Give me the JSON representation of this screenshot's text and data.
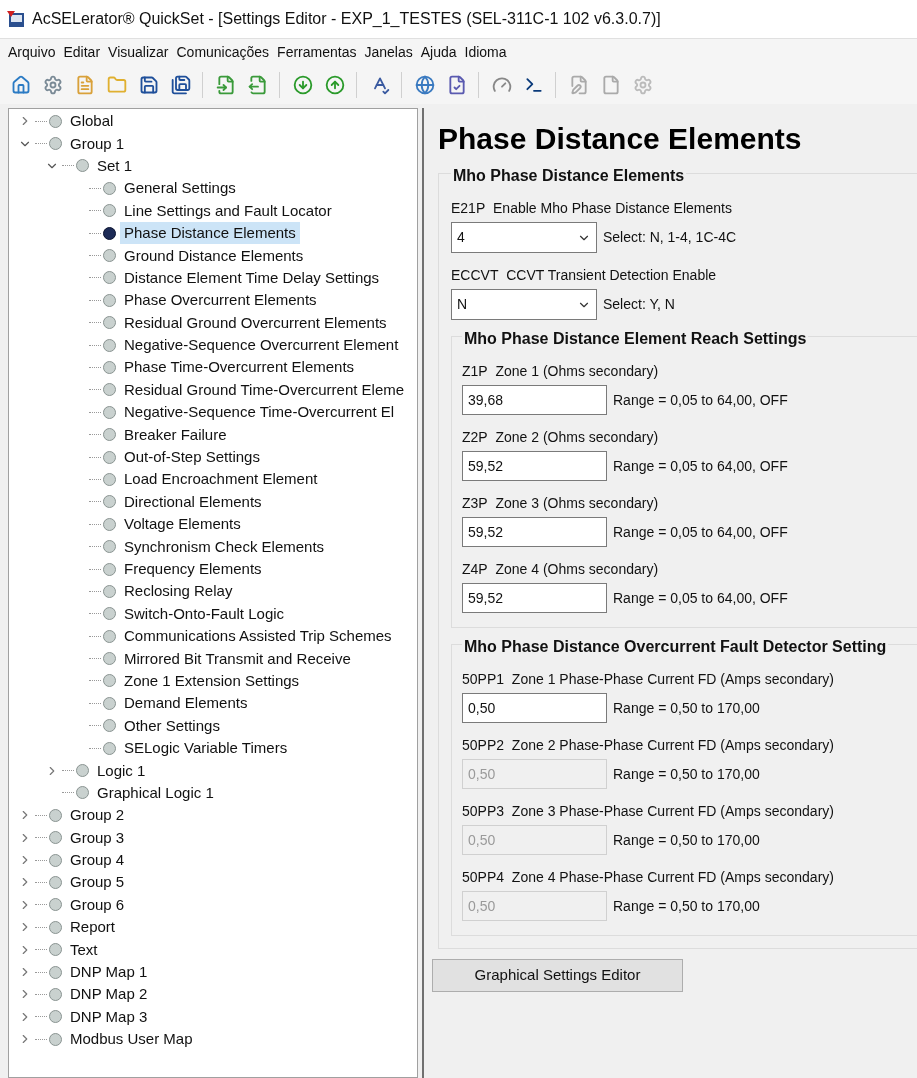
{
  "window": {
    "title": "AcSELerator® QuickSet - [Settings Editor - EXP_1_TESTES (SEL-311C-1 102 v6.3.0.7)]"
  },
  "menu": [
    "Arquivo",
    "Editar",
    "Visualizar",
    "Comunicações",
    "Ferramentas",
    "Janelas",
    "Ajuda",
    "Idioma"
  ],
  "tree": [
    {
      "label": "Global",
      "expanded": false,
      "selected": false
    },
    {
      "label": "Group 1",
      "expanded": true,
      "selected": false,
      "children": [
        {
          "label": "Set 1",
          "expanded": true,
          "selected": false,
          "children": [
            {
              "label": "General Settings",
              "selected": false
            },
            {
              "label": "Line Settings and Fault Locator",
              "selected": false
            },
            {
              "label": "Phase Distance Elements",
              "selected": true
            },
            {
              "label": "Ground Distance Elements",
              "selected": false
            },
            {
              "label": "Distance Element Time Delay Settings",
              "selected": false
            },
            {
              "label": "Phase Overcurrent Elements",
              "selected": false
            },
            {
              "label": "Residual Ground Overcurrent Elements",
              "selected": false
            },
            {
              "label": "Negative-Sequence Overcurrent Element",
              "selected": false
            },
            {
              "label": "Phase Time-Overcurrent Elements",
              "selected": false
            },
            {
              "label": "Residual Ground Time-Overcurrent Eleme",
              "selected": false
            },
            {
              "label": "Negative-Sequence Time-Overcurrent El",
              "selected": false
            },
            {
              "label": "Breaker Failure",
              "selected": false
            },
            {
              "label": "Out-of-Step Settings",
              "selected": false
            },
            {
              "label": "Load Encroachment Element",
              "selected": false
            },
            {
              "label": "Directional Elements",
              "selected": false
            },
            {
              "label": "Voltage Elements",
              "selected": false
            },
            {
              "label": "Synchronism Check Elements",
              "selected": false
            },
            {
              "label": "Frequency Elements",
              "selected": false
            },
            {
              "label": "Reclosing Relay",
              "selected": false
            },
            {
              "label": "Switch-Onto-Fault Logic",
              "selected": false
            },
            {
              "label": "Communications Assisted Trip Schemes",
              "selected": false
            },
            {
              "label": "Mirrored Bit Transmit and Receive",
              "selected": false
            },
            {
              "label": "Zone 1 Extension Settings",
              "selected": false
            },
            {
              "label": "Demand Elements",
              "selected": false
            },
            {
              "label": "Other Settings",
              "selected": false
            },
            {
              "label": "SELogic Variable Timers",
              "selected": false
            }
          ]
        },
        {
          "label": "Logic 1",
          "expanded": false,
          "selected": false
        },
        {
          "label": "Graphical Logic 1",
          "selected": false
        }
      ]
    },
    {
      "label": "Group 2",
      "expanded": false,
      "selected": false
    },
    {
      "label": "Group 3",
      "expanded": false,
      "selected": false
    },
    {
      "label": "Group 4",
      "expanded": false,
      "selected": false
    },
    {
      "label": "Group 5",
      "expanded": false,
      "selected": false
    },
    {
      "label": "Group 6",
      "expanded": false,
      "selected": false
    },
    {
      "label": "Report",
      "expanded": false,
      "selected": false
    },
    {
      "label": "Text",
      "expanded": false,
      "selected": false
    },
    {
      "label": "DNP Map 1",
      "expanded": false,
      "selected": false
    },
    {
      "label": "DNP Map 2",
      "expanded": false,
      "selected": false
    },
    {
      "label": "DNP Map 3",
      "expanded": false,
      "selected": false
    },
    {
      "label": "Modbus User Map",
      "expanded": false,
      "selected": false
    }
  ],
  "editor": {
    "title": "Phase Distance Elements",
    "section": {
      "title": "Mho Phase Distance Elements",
      "settings": [
        {
          "code": "E21P",
          "label": "Enable Mho Phase Distance Elements",
          "kind": "select",
          "value": "4",
          "hint": "Select: N, 1-4, 1C-4C"
        },
        {
          "code": "ECCVT",
          "label": "CCVT Transient Detection Enable",
          "kind": "select",
          "value": "N",
          "hint": "Select: Y, N"
        }
      ],
      "subsections": [
        {
          "title": "Mho Phase Distance Element Reach Settings",
          "settings": [
            {
              "code": "Z1P",
              "label": "Zone 1 (Ohms secondary)",
              "kind": "text",
              "value": "39,68",
              "hint": "Range = 0,05 to 64,00, OFF",
              "disabled": false
            },
            {
              "code": "Z2P",
              "label": "Zone 2 (Ohms secondary)",
              "kind": "text",
              "value": "59,52",
              "hint": "Range = 0,05 to 64,00, OFF",
              "disabled": false
            },
            {
              "code": "Z3P",
              "label": "Zone 3 (Ohms secondary)",
              "kind": "text",
              "value": "59,52",
              "hint": "Range = 0,05 to 64,00, OFF",
              "disabled": false
            },
            {
              "code": "Z4P",
              "label": "Zone 4 (Ohms secondary)",
              "kind": "text",
              "value": "59,52",
              "hint": "Range = 0,05 to 64,00, OFF",
              "disabled": false
            }
          ]
        },
        {
          "title": "Mho Phase Distance Overcurrent Fault Detector Setting",
          "settings": [
            {
              "code": "50PP1",
              "label": "Zone 1 Phase-Phase Current FD (Amps secondary)",
              "kind": "text",
              "value": "0,50",
              "hint": "Range = 0,50 to 170,00",
              "disabled": false
            },
            {
              "code": "50PP2",
              "label": "Zone 2 Phase-Phase Current FD (Amps secondary)",
              "kind": "text",
              "value": "0,50",
              "hint": "Range = 0,50 to 170,00",
              "disabled": true
            },
            {
              "code": "50PP3",
              "label": "Zone 3 Phase-Phase Current FD (Amps secondary)",
              "kind": "text",
              "value": "0,50",
              "hint": "Range = 0,50 to 170,00",
              "disabled": true
            },
            {
              "code": "50PP4",
              "label": "Zone 4 Phase-Phase Current FD (Amps secondary)",
              "kind": "text",
              "value": "0,50",
              "hint": "Range = 0,50 to 170,00",
              "disabled": true
            }
          ]
        }
      ]
    },
    "button": "Graphical Settings Editor"
  }
}
